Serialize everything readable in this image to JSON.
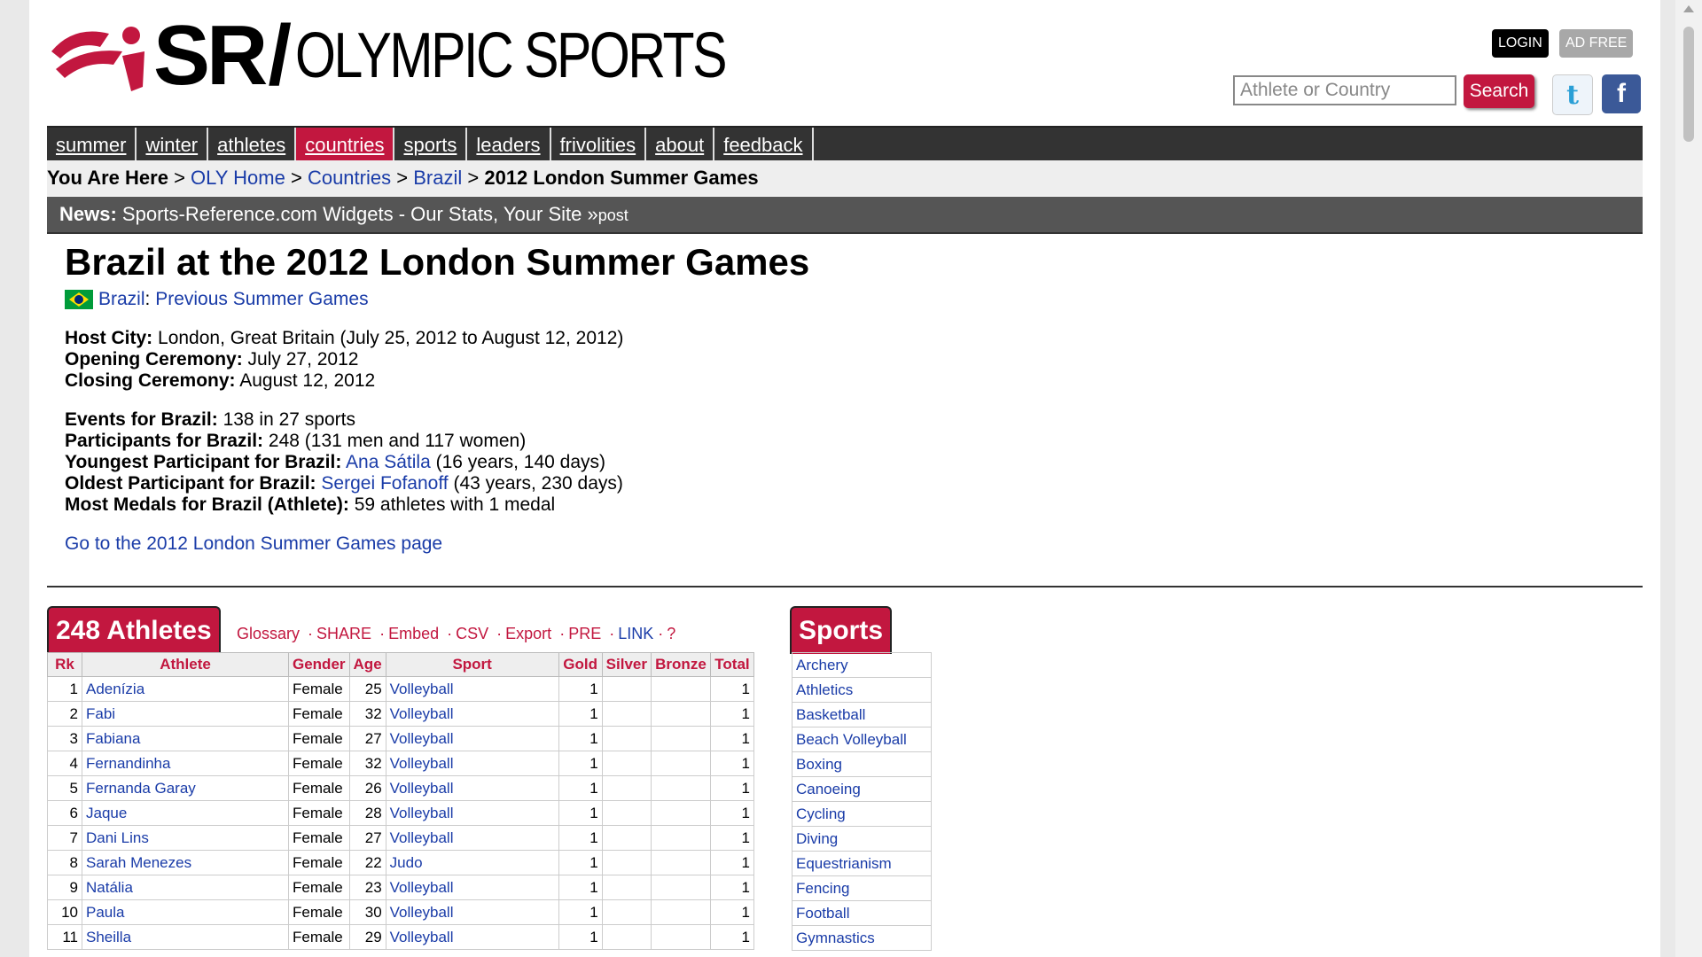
{
  "brand": {
    "sr": "SR",
    "slash": "/",
    "olympic": "OLYMPIC SPORTS"
  },
  "header": {
    "login": "LOGIN",
    "adfree": "AD FREE",
    "search_placeholder": "Athlete or Country",
    "search_button": "Search",
    "twitter_icon": "t",
    "facebook_icon": "f"
  },
  "nav": [
    "summer",
    "winter",
    "athletes",
    "countries",
    "sports",
    "leaders",
    "frivolities",
    "about",
    "feedback"
  ],
  "breadcrumb": {
    "prefix": "You Are Here",
    "sep": ">",
    "items": [
      "OLY Home",
      "Countries",
      "Brazil"
    ],
    "current": "2012 London Summer Games"
  },
  "news": {
    "label": "News:",
    "link": "Sports-Reference.com Widgets - Our Stats, Your Site",
    "post_prefix": "»",
    "post": "post"
  },
  "page": {
    "title": "Brazil at the 2012 London Summer Games",
    "country_link": "Brazil",
    "prev_link": "Previous Summer Games",
    "host_city_label": "Host City:",
    "host_city": "London, Great Britain (July 25, 2012 to August 12, 2012)",
    "opening_label": "Opening Ceremony:",
    "opening": "July 27, 2012",
    "closing_label": "Closing Ceremony:",
    "closing": "August 12, 2012",
    "events_label": "Events for Brazil:",
    "events": "138 in 27 sports",
    "participants_label": "Participants for Brazil:",
    "participants": "248 (131 men and 117 women)",
    "youngest_label": "Youngest Participant for Brazil:",
    "youngest_name": "Ana Sátila",
    "youngest_age": "(16 years, 140 days)",
    "oldest_label": "Oldest Participant for Brazil:",
    "oldest_name": "Sergei Fofanoff",
    "oldest_age": "(43 years, 230 days)",
    "most_medals_label": "Most Medals for Brazil (Athlete):",
    "most_medals": "59 athletes with 1 medal",
    "goto_link": "Go to the 2012 London Summer Games page"
  },
  "athletes_table": {
    "tab": "248 Athletes",
    "tools": {
      "glossary": "Glossary",
      "share": "SHARE",
      "embed": "Embed",
      "csv": "CSV",
      "export": "Export",
      "pre": "PRE",
      "link": "LINK",
      "help": "?",
      "dot": "·"
    },
    "columns": [
      "Rk",
      "Athlete",
      "Gender",
      "Age",
      "Sport",
      "Gold",
      "Silver",
      "Bronze",
      "Total"
    ],
    "rows": [
      {
        "rk": "1",
        "athlete": "Adenízia",
        "gender": "Female",
        "age": "25",
        "sport": "Volleyball",
        "gold": "1",
        "silver": "",
        "bronze": "",
        "total": "1"
      },
      {
        "rk": "2",
        "athlete": "Fabi",
        "gender": "Female",
        "age": "32",
        "sport": "Volleyball",
        "gold": "1",
        "silver": "",
        "bronze": "",
        "total": "1"
      },
      {
        "rk": "3",
        "athlete": "Fabiana",
        "gender": "Female",
        "age": "27",
        "sport": "Volleyball",
        "gold": "1",
        "silver": "",
        "bronze": "",
        "total": "1"
      },
      {
        "rk": "4",
        "athlete": "Fernandinha",
        "gender": "Female",
        "age": "32",
        "sport": "Volleyball",
        "gold": "1",
        "silver": "",
        "bronze": "",
        "total": "1"
      },
      {
        "rk": "5",
        "athlete": "Fernanda Garay",
        "gender": "Female",
        "age": "26",
        "sport": "Volleyball",
        "gold": "1",
        "silver": "",
        "bronze": "",
        "total": "1"
      },
      {
        "rk": "6",
        "athlete": "Jaque",
        "gender": "Female",
        "age": "28",
        "sport": "Volleyball",
        "gold": "1",
        "silver": "",
        "bronze": "",
        "total": "1"
      },
      {
        "rk": "7",
        "athlete": "Dani Lins",
        "gender": "Female",
        "age": "27",
        "sport": "Volleyball",
        "gold": "1",
        "silver": "",
        "bronze": "",
        "total": "1"
      },
      {
        "rk": "8",
        "athlete": "Sarah Menezes",
        "gender": "Female",
        "age": "22",
        "sport": "Judo",
        "gold": "1",
        "silver": "",
        "bronze": "",
        "total": "1"
      },
      {
        "rk": "9",
        "athlete": "Natália",
        "gender": "Female",
        "age": "23",
        "sport": "Volleyball",
        "gold": "1",
        "silver": "",
        "bronze": "",
        "total": "1"
      },
      {
        "rk": "10",
        "athlete": "Paula",
        "gender": "Female",
        "age": "30",
        "sport": "Volleyball",
        "gold": "1",
        "silver": "",
        "bronze": "",
        "total": "1"
      },
      {
        "rk": "11",
        "athlete": "Sheilla",
        "gender": "Female",
        "age": "29",
        "sport": "Volleyball",
        "gold": "1",
        "silver": "",
        "bronze": "",
        "total": "1"
      }
    ]
  },
  "sports_table": {
    "tab": "Sports",
    "items": [
      "Archery",
      "Athletics",
      "Basketball",
      "Beach Volleyball",
      "Boxing",
      "Canoeing",
      "Cycling",
      "Diving",
      "Equestrianism",
      "Fencing",
      "Football",
      "Gymnastics"
    ]
  },
  "colors": {
    "accent": "#c2173f",
    "link": "#1a3ca8",
    "nav_bg": "#333333"
  }
}
